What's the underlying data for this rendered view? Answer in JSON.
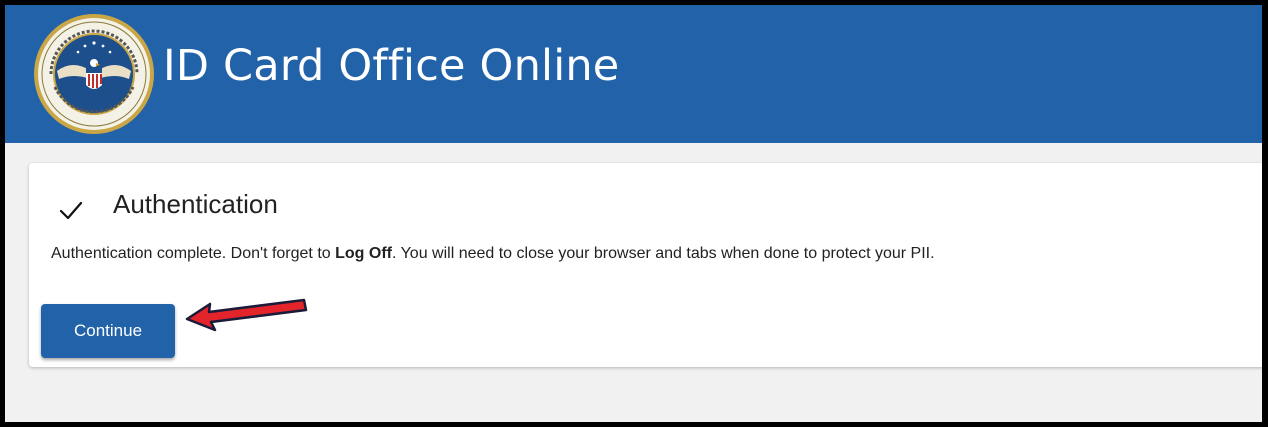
{
  "header": {
    "title": "ID Card Office Online",
    "background_color": "#2262a9",
    "seal_icon": "dod-seal-icon"
  },
  "auth": {
    "status_icon": "checkmark-icon",
    "title": "Authentication",
    "message_before": "Authentication complete. Don't forget to ",
    "message_bold": "Log Off",
    "message_after": ". You will need to close your browser and tabs when done to protect your PII."
  },
  "actions": {
    "continue_label": "Continue",
    "button_color": "#2262a9"
  },
  "annotation": {
    "arrow_icon": "red-arrow-icon",
    "arrow_color": "#e3242b"
  }
}
